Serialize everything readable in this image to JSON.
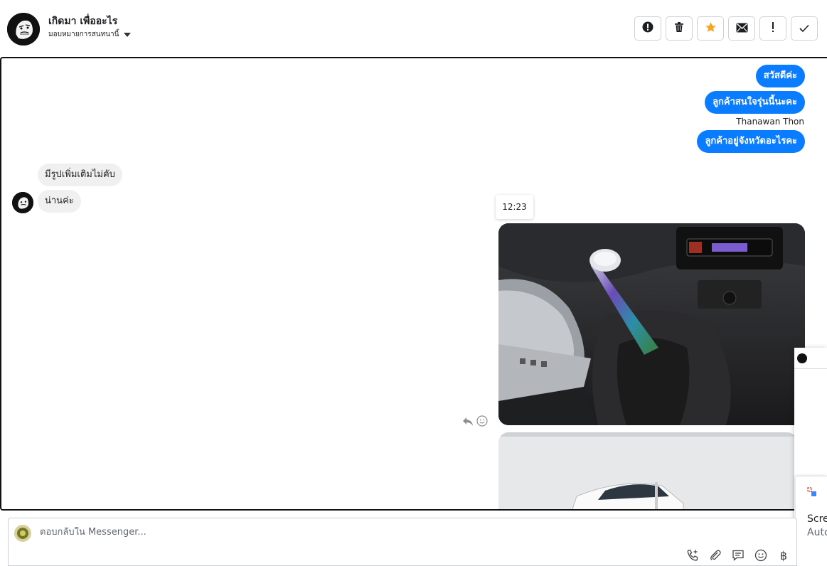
{
  "header": {
    "title": "เกิดมา เพื่ออะไร",
    "subtitle": "มอบหมายการสนทนานี้",
    "actions": [
      {
        "name": "spam",
        "icon": "alert-circle-icon"
      },
      {
        "name": "delete",
        "icon": "trash-icon"
      },
      {
        "name": "star",
        "icon": "star-icon",
        "color": "#f5a623"
      },
      {
        "name": "mark-unread",
        "icon": "envelope-icon"
      },
      {
        "name": "follow-up",
        "icon": "exclamation-icon"
      },
      {
        "name": "done",
        "icon": "check-icon"
      }
    ]
  },
  "conversation": {
    "messages_out": [
      {
        "text": "สวัสดีค่ะ"
      },
      {
        "text": "ลูกค้าสนใจรุ่นนี้นะคะ"
      },
      {
        "text": "ลูกค้าอยู่จังหวัดอะไรคะ"
      }
    ],
    "sender_name": "Thanawan Thon",
    "messages_in": [
      {
        "text": "มีรูปเพิ่มเติมไม่คับ"
      },
      {
        "text": "น่านค่ะ"
      }
    ],
    "timestamp": "12:23"
  },
  "notification": {
    "line1": "Scree",
    "line2": "Auto"
  },
  "reply": {
    "placeholder": "ตอบกลับใน Messenger...",
    "tools": [
      "phone-plus-icon",
      "paperclip-icon",
      "saved-reply-icon",
      "emoji-icon",
      "baht-icon"
    ],
    "baht_symbol": "฿"
  },
  "colors": {
    "accent": "#0a7cff",
    "incoming_bubble": "#f0f0f0",
    "star": "#f5a623"
  }
}
